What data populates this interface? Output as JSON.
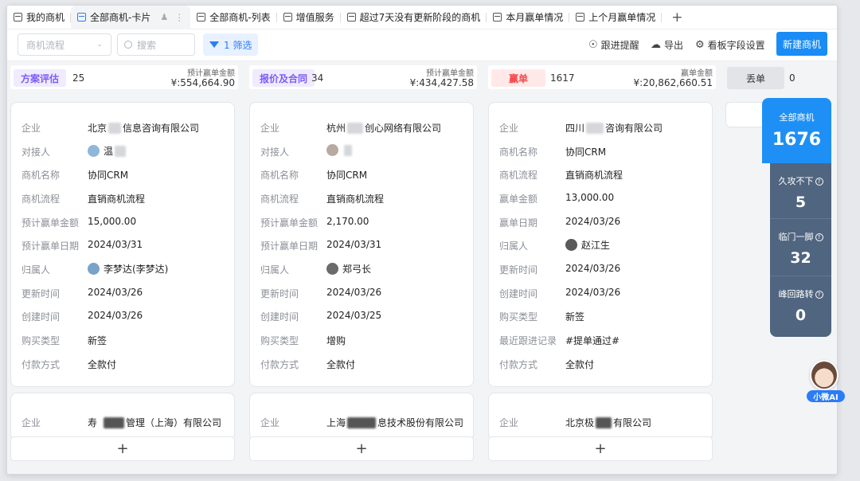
{
  "tabs": [
    {
      "label": "我的商机"
    },
    {
      "label": "全部商机-卡片"
    },
    {
      "label": "全部商机-列表"
    },
    {
      "label": "增值服务"
    },
    {
      "label": "超过7天没有更新阶段的商机"
    },
    {
      "label": "本月赢单情况"
    },
    {
      "label": "上个月赢单情况"
    }
  ],
  "toolbar": {
    "flow_select": "商机流程",
    "search_placeholder": "搜索",
    "filter_label": "1 筛选",
    "follow_reminder": "跟进提醒",
    "export": "导出",
    "field_settings": "看板字段设置",
    "new_button": "新建商机"
  },
  "columns": [
    {
      "stage": "方案评估",
      "count": "25",
      "amount_label": "预计赢单金额",
      "amount": "¥:554,664.90",
      "color": "#7b5cf5",
      "bg": "#f0ebff"
    },
    {
      "stage": "报价及合同",
      "count": "34",
      "amount_label": "预计赢单金额",
      "amount": "¥:434,427.58",
      "color": "#7b5cf5",
      "bg": "#f0ebff"
    },
    {
      "stage": "赢单",
      "count": "1617",
      "amount_label": "赢单金额",
      "amount": "¥:20,862,660.51",
      "color": "#f5484a",
      "bg": "#ffe9e8"
    },
    {
      "stage": "丢单",
      "count": "0",
      "color": "#333333",
      "bg": "#eceef1"
    }
  ],
  "cards": [
    {
      "fields": [
        {
          "label": "企业",
          "value_a": "北京",
          "value_b": "信息咨询有限公司"
        },
        {
          "label": "对接人",
          "value_a": "温"
        },
        {
          "label": "商机名称",
          "value": "协同CRM"
        },
        {
          "label": "商机流程",
          "value": "直销商机流程"
        },
        {
          "label": "预计赢单金额",
          "value": "15,000.00"
        },
        {
          "label": "预计赢单日期",
          "value": "2024/03/31"
        },
        {
          "label": "归属人",
          "value": "李梦达(李梦达)"
        },
        {
          "label": "更新时间",
          "value": "2024/03/26"
        },
        {
          "label": "创建时间",
          "value": "2024/03/26"
        },
        {
          "label": "购买类型",
          "value": "新签"
        },
        {
          "label": "付款方式",
          "value": "全款付"
        }
      ]
    },
    {
      "fields": [
        {
          "label": "企业",
          "value_a": "杭州",
          "value_b": "创心网络有限公司"
        },
        {
          "label": "对接人",
          "value_a": ""
        },
        {
          "label": "商机名称",
          "value": "协同CRM"
        },
        {
          "label": "商机流程",
          "value": "直销商机流程"
        },
        {
          "label": "预计赢单金额",
          "value": "2,170.00"
        },
        {
          "label": "预计赢单日期",
          "value": "2024/03/31"
        },
        {
          "label": "归属人",
          "value": "郑弓长"
        },
        {
          "label": "更新时间",
          "value": "2024/03/26"
        },
        {
          "label": "创建时间",
          "value": "2024/03/25"
        },
        {
          "label": "购买类型",
          "value": "增购"
        },
        {
          "label": "付款方式",
          "value": "全款付"
        }
      ]
    },
    {
      "fields": [
        {
          "label": "企业",
          "value_a": "四川",
          "value_b": "咨询有限公司"
        },
        {
          "label": "商机名称",
          "value": "协同CRM"
        },
        {
          "label": "商机流程",
          "value": "直销商机流程"
        },
        {
          "label": "赢单金额",
          "value": "13,000.00"
        },
        {
          "label": "赢单日期",
          "value": "2024/03/26"
        },
        {
          "label": "归属人",
          "value": "赵江生"
        },
        {
          "label": "更新时间",
          "value": "2024/03/26"
        },
        {
          "label": "创建时间",
          "value": "2024/03/26"
        },
        {
          "label": "购买类型",
          "value": "新签"
        },
        {
          "label": "最近跟进记录",
          "value": "#提单通过#"
        },
        {
          "label": "付款方式",
          "value": "全款付"
        }
      ]
    }
  ],
  "next_cards": [
    {
      "label": "企业",
      "value_a": "寿",
      "value_b": "管理（上海）有限公司"
    },
    {
      "label": "企业",
      "value_a": "上海",
      "value_b": "息技术股份有限公司"
    },
    {
      "label": "企业",
      "value_a": "北京极",
      "value_b": "有限公司"
    }
  ],
  "add_label": "+",
  "stats": {
    "total_label": "全部商机",
    "total": "1676",
    "items": [
      {
        "label": "久攻不下",
        "value": "5"
      },
      {
        "label": "临门一脚",
        "value": "32"
      },
      {
        "label": "峰回路转",
        "value": "0"
      }
    ]
  },
  "ai_label": "小微AI"
}
